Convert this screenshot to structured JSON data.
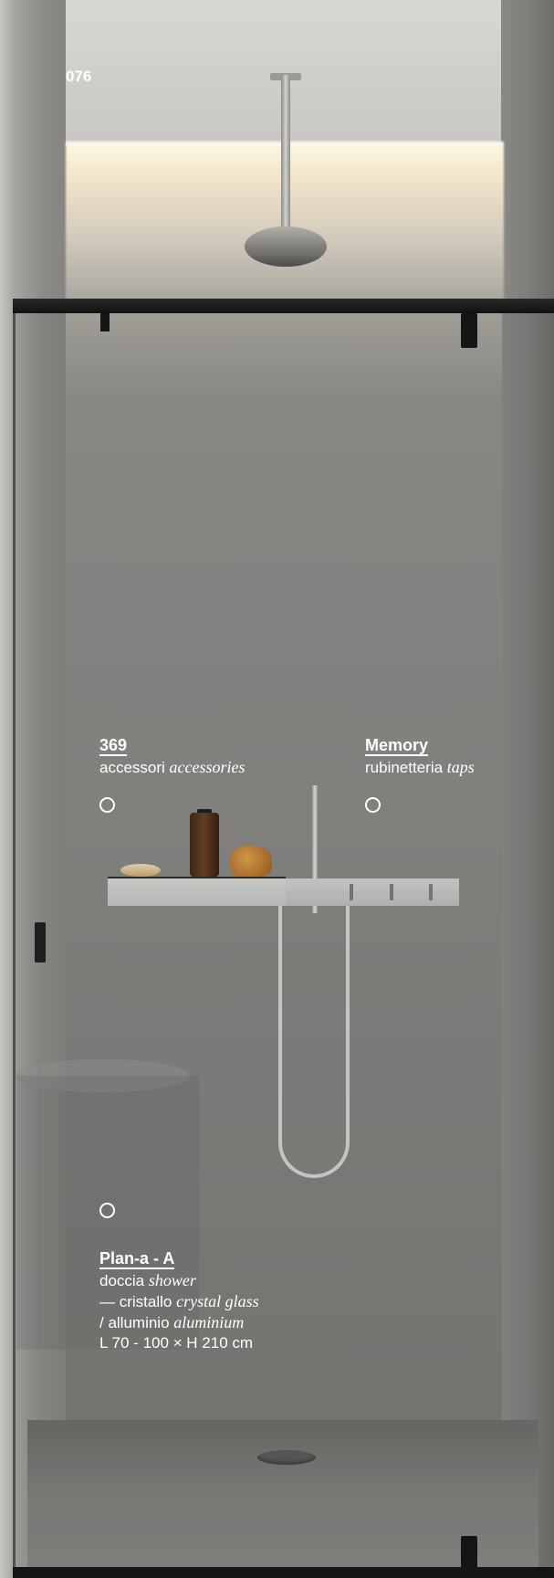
{
  "page_number": "076",
  "hotspots": [
    {
      "title": "369",
      "lines": [
        {
          "text": "accessori",
          "italic": "accessories"
        }
      ]
    },
    {
      "title": "Memory",
      "lines": [
        {
          "text": "rubinetteria",
          "italic": "taps"
        }
      ]
    },
    {
      "title": "Plan-a - A",
      "lines": [
        {
          "text": "doccia",
          "italic": "shower"
        },
        {
          "text": "— cristallo",
          "italic": "crystal glass"
        },
        {
          "text": "/ alluminio",
          "italic": "aluminium"
        },
        {
          "text": "L 70 - 100 × H 210 cm",
          "italic": ""
        }
      ]
    }
  ]
}
